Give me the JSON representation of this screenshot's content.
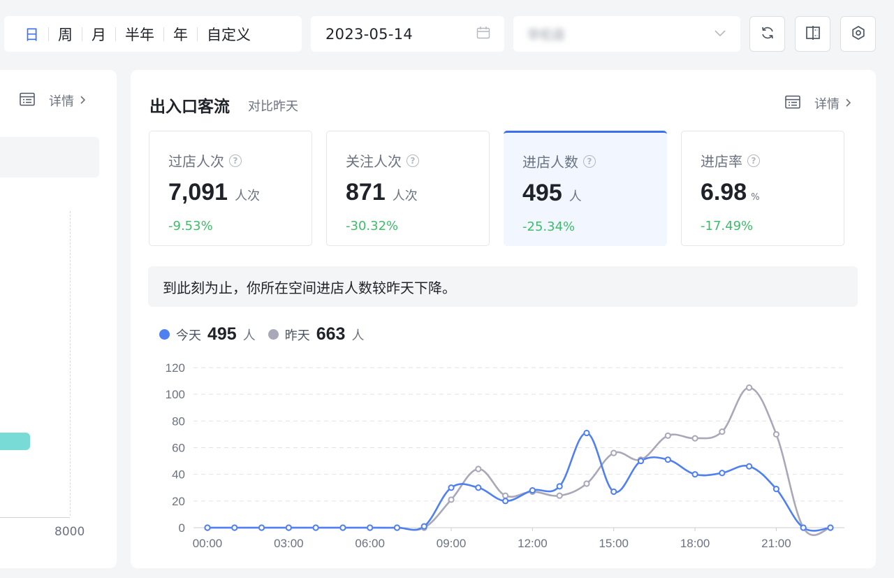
{
  "toolbar": {
    "period_tabs": [
      "日",
      "周",
      "月",
      "半年",
      "年",
      "自定义"
    ],
    "date": "2023-05-14",
    "location_placeholder": "华伦店"
  },
  "left_panel": {
    "detail_label": "详情",
    "axis_tick": "8000"
  },
  "panel": {
    "title": "出入口客流",
    "subtitle": "对比昨天",
    "detail_label": "详情"
  },
  "metrics": [
    {
      "label": "过店人次",
      "value": "7,091",
      "unit": "人次",
      "delta": "-9.53%"
    },
    {
      "label": "关注人次",
      "value": "871",
      "unit": "人次",
      "delta": "-30.32%"
    },
    {
      "label": "进店人数",
      "value": "495",
      "unit": "人",
      "delta": "-25.34%"
    },
    {
      "label": "进店率",
      "value": "6.98",
      "unit": "%",
      "delta": "-17.49%"
    }
  ],
  "notice": "到此刻为止，你所在空间进店人数较昨天下降。",
  "legend": {
    "today": {
      "name": "今天",
      "value": "495",
      "unit": "人"
    },
    "yesterday": {
      "name": "昨天",
      "value": "663",
      "unit": "人"
    }
  },
  "colors": {
    "today": "#4f7ff0",
    "yesterday": "#a9a8b8",
    "positive_delta": "#3dbd6a",
    "accent": "#3a6ff0"
  },
  "chart_data": {
    "type": "line",
    "x": [
      "00:00",
      "01:00",
      "02:00",
      "03:00",
      "04:00",
      "05:00",
      "06:00",
      "07:00",
      "08:00",
      "09:00",
      "10:00",
      "11:00",
      "12:00",
      "13:00",
      "14:00",
      "15:00",
      "16:00",
      "17:00",
      "18:00",
      "19:00",
      "20:00",
      "21:00",
      "22:00",
      "23:00"
    ],
    "x_tick_labels": [
      "00:00",
      "03:00",
      "06:00",
      "09:00",
      "12:00",
      "15:00",
      "18:00",
      "21:00"
    ],
    "ylim": [
      0,
      120
    ],
    "y_ticks": [
      0,
      20,
      40,
      60,
      80,
      100,
      120
    ],
    "grid": true,
    "series": [
      {
        "name": "今天",
        "values": [
          0,
          0,
          0,
          0,
          0,
          0,
          0,
          0,
          1,
          30,
          30,
          20,
          28,
          31,
          71,
          27,
          50,
          51,
          40,
          41,
          46,
          29,
          0,
          0
        ]
      },
      {
        "name": "昨天",
        "values": [
          0,
          0,
          0,
          0,
          0,
          0,
          0,
          0,
          0,
          21,
          44,
          24,
          27,
          24,
          33,
          56,
          51,
          69,
          67,
          72,
          105,
          70,
          0,
          0
        ]
      }
    ]
  }
}
